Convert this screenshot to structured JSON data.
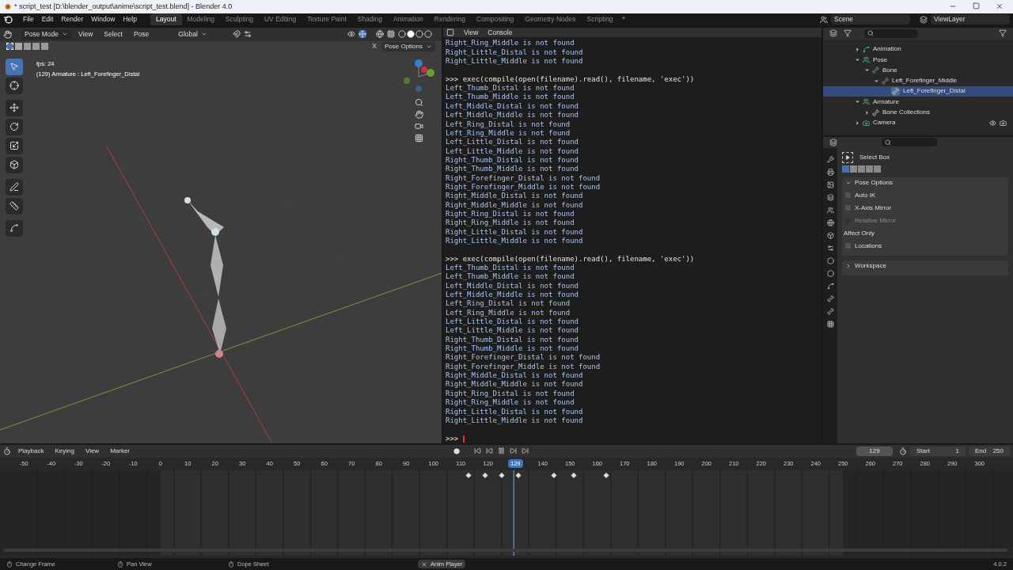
{
  "window": {
    "title": "* script_test [D:\\blender_output\\anime\\script_test.blend] - Blender 4.0"
  },
  "menu": [
    "File",
    "Edit",
    "Render",
    "Window",
    "Help"
  ],
  "workspaces": [
    {
      "label": "Layout",
      "selected": true
    },
    {
      "label": "Modeling",
      "selected": false
    },
    {
      "label": "Sculpting",
      "selected": false
    },
    {
      "label": "UV Editing",
      "selected": false
    },
    {
      "label": "Texture Paint",
      "selected": false
    },
    {
      "label": "Shading",
      "selected": false
    },
    {
      "label": "Animation",
      "selected": false
    },
    {
      "label": "Rendering",
      "selected": false
    },
    {
      "label": "Compositing",
      "selected": false
    },
    {
      "label": "Geometry Nodes",
      "selected": false
    },
    {
      "label": "Scripting",
      "selected": false
    }
  ],
  "add_workspace": "+",
  "scene": "Scene",
  "view_layer": "ViewLayer",
  "viewport": {
    "mode": "Pose Mode",
    "menus": [
      "View",
      "Select",
      "Pose"
    ],
    "orientation": "Global",
    "pose_options": "Pose Options",
    "close": "X",
    "overlay": [
      "fps: 24",
      "(129) Armature : Left_Forefinger_Distal"
    ]
  },
  "console": {
    "menus": [
      "View",
      "Console"
    ],
    "cursor": true,
    "lines": [
      {
        "kind": "output",
        "text": "Right_Ring_Middle is not found"
      },
      {
        "kind": "output",
        "text": "Right_Little_Distal is not found"
      },
      {
        "kind": "output",
        "text": "Right_Little_Middle is not found"
      },
      {
        "kind": "input",
        "text": ">>> exec(compile(open(filename).read(), filename, 'exec'))"
      },
      {
        "kind": "output",
        "text": "Left_Thumb_Distal is not found"
      },
      {
        "kind": "output",
        "text": "Left_Thumb_Middle is not found"
      },
      {
        "kind": "output",
        "text": "Left_Middle_Distal is not found"
      },
      {
        "kind": "output",
        "text": "Left_Middle_Middle is not found"
      },
      {
        "kind": "output",
        "text": "Left_Ring_Distal is not found"
      },
      {
        "kind": "output",
        "text": "Left_Ring_Middle is not found"
      },
      {
        "kind": "output",
        "text": "Left_Little_Distal is not found"
      },
      {
        "kind": "output",
        "text": "Left_Little_Middle is not found"
      },
      {
        "kind": "output",
        "text": "Right_Thumb_Distal is not found"
      },
      {
        "kind": "output",
        "text": "Right_Thumb_Middle is not found"
      },
      {
        "kind": "output",
        "text": "Right_Forefinger_Distal is not found"
      },
      {
        "kind": "output",
        "text": "Right_Forefinger_Middle is not found"
      },
      {
        "kind": "output",
        "text": "Right_Middle_Distal is not found"
      },
      {
        "kind": "output",
        "text": "Right_Middle_Middle is not found"
      },
      {
        "kind": "output",
        "text": "Right_Ring_Distal is not found"
      },
      {
        "kind": "output",
        "text": "Right_Ring_Middle is not found"
      },
      {
        "kind": "output",
        "text": "Right_Little_Distal is not found"
      },
      {
        "kind": "output",
        "text": "Right_Little_Middle is not found"
      },
      {
        "kind": "input",
        "text": ">>> exec(compile(open(filename).read(), filename, 'exec'))"
      },
      {
        "kind": "output",
        "text": "Left_Thumb_Distal is not found"
      },
      {
        "kind": "output",
        "text": "Left_Thumb_Middle is not found"
      },
      {
        "kind": "output",
        "text": "Left_Middle_Distal is not found"
      },
      {
        "kind": "output",
        "text": "Left_Middle_Middle is not found"
      },
      {
        "kind": "output",
        "text": "Left_Ring_Distal is not found"
      },
      {
        "kind": "output",
        "text": "Left_Ring_Middle is not found"
      },
      {
        "kind": "output",
        "text": "Left_Little_Distal is not found"
      },
      {
        "kind": "output",
        "text": "Left_Little_Middle is not found"
      },
      {
        "kind": "output",
        "text": "Right_Thumb_Distal is not found"
      },
      {
        "kind": "output",
        "text": "Right_Thumb_Middle is not found"
      },
      {
        "kind": "output",
        "text": "Right_Forefinger_Distal is not found"
      },
      {
        "kind": "output",
        "text": "Right_Forefinger_Middle is not found"
      },
      {
        "kind": "output",
        "text": "Right_Middle_Distal is not found"
      },
      {
        "kind": "output",
        "text": "Right_Middle_Middle is not found"
      },
      {
        "kind": "output",
        "text": "Right_Ring_Distal is not found"
      },
      {
        "kind": "output",
        "text": "Right_Ring_Middle is not found"
      },
      {
        "kind": "output",
        "text": "Right_Little_Distal is not found"
      },
      {
        "kind": "output",
        "text": "Right_Little_Middle is not found"
      },
      {
        "kind": "input",
        "text": ">>>"
      }
    ]
  },
  "outliner": {
    "items": [
      {
        "label": "Animation",
        "kind": "action",
        "expanded": false,
        "selected": false
      },
      {
        "label": "Pose",
        "kind": "pose",
        "expanded": true,
        "selected": false,
        "children": [
          {
            "label": "Bone",
            "kind": "bone",
            "expanded": true,
            "selected": false,
            "children": [
              {
                "label": "Left_Forefinger_Middle",
                "kind": "bone",
                "expanded": true,
                "selected": false,
                "children": [
                  {
                    "label": "Left_Forefinger_Distal",
                    "kind": "leaf",
                    "selected": true
                  }
                ]
              }
            ]
          }
        ]
      },
      {
        "label": "Armature",
        "kind": "armature",
        "expanded": true,
        "selected": false,
        "children": [
          {
            "label": "Bone Collections",
            "kind": "collection",
            "expanded": false,
            "selected": false
          }
        ]
      },
      {
        "label": "Camera",
        "kind": "camera",
        "expanded": false,
        "selected": false
      }
    ]
  },
  "properties": {
    "tool": "Select Box",
    "panels": [
      {
        "title": "Pose Options",
        "expanded": true,
        "rows": [
          {
            "kind": "checkbox",
            "label": "Auto IK",
            "checked": false,
            "disabled": false
          },
          {
            "kind": "checkbox",
            "label": "X-Axis Mirror",
            "checked": false,
            "disabled": false
          },
          {
            "kind": "checkbox",
            "label": "Relative Mirror",
            "checked": false,
            "disabled": true
          },
          {
            "kind": "heading",
            "label": "Affect Only"
          },
          {
            "kind": "checkbox",
            "label": "Locations",
            "checked": false,
            "disabled": false
          }
        ]
      },
      {
        "title": "Workspace",
        "expanded": false
      }
    ]
  },
  "timeline": {
    "menus": [
      "Playback",
      "Keying",
      "View",
      "Marker"
    ],
    "frame": "129",
    "start_label": "Start",
    "start": "1",
    "end_label": "End",
    "end": "250",
    "ruler": [
      {
        "label": "-50",
        "current": false
      },
      {
        "label": "-40",
        "current": false
      },
      {
        "label": "-30",
        "current": false
      },
      {
        "label": "-20",
        "current": false
      },
      {
        "label": "-10",
        "current": false
      },
      {
        "label": "0",
        "current": false
      },
      {
        "label": "10",
        "current": false
      },
      {
        "label": "20",
        "current": false
      },
      {
        "label": "30",
        "current": false
      },
      {
        "label": "40",
        "current": false
      },
      {
        "label": "50",
        "current": false
      },
      {
        "label": "60",
        "current": false
      },
      {
        "label": "70",
        "current": false
      },
      {
        "label": "80",
        "current": false
      },
      {
        "label": "90",
        "current": false
      },
      {
        "label": "100",
        "current": false
      },
      {
        "label": "110",
        "current": false
      },
      {
        "label": "120",
        "current": false
      },
      {
        "label": "129",
        "current": true
      },
      {
        "label": "140",
        "current": false
      },
      {
        "label": "150",
        "current": false
      },
      {
        "label": "160",
        "current": false
      },
      {
        "label": "170",
        "current": false
      },
      {
        "label": "180",
        "current": false
      },
      {
        "label": "190",
        "current": false
      },
      {
        "label": "200",
        "current": false
      },
      {
        "label": "210",
        "current": false
      },
      {
        "label": "220",
        "current": false
      },
      {
        "label": "230",
        "current": false
      },
      {
        "label": "240",
        "current": false
      },
      {
        "label": "250",
        "current": false
      },
      {
        "label": "260",
        "current": false
      },
      {
        "label": "270",
        "current": false
      },
      {
        "label": "280",
        "current": false
      },
      {
        "label": "290",
        "current": false
      },
      {
        "label": "300",
        "current": false
      }
    ]
  },
  "status_bar": {
    "items": [
      "Change Frame",
      "Pan View",
      "Dope Sheet"
    ],
    "badge": "Anim Player",
    "version": "4.0.2"
  }
}
